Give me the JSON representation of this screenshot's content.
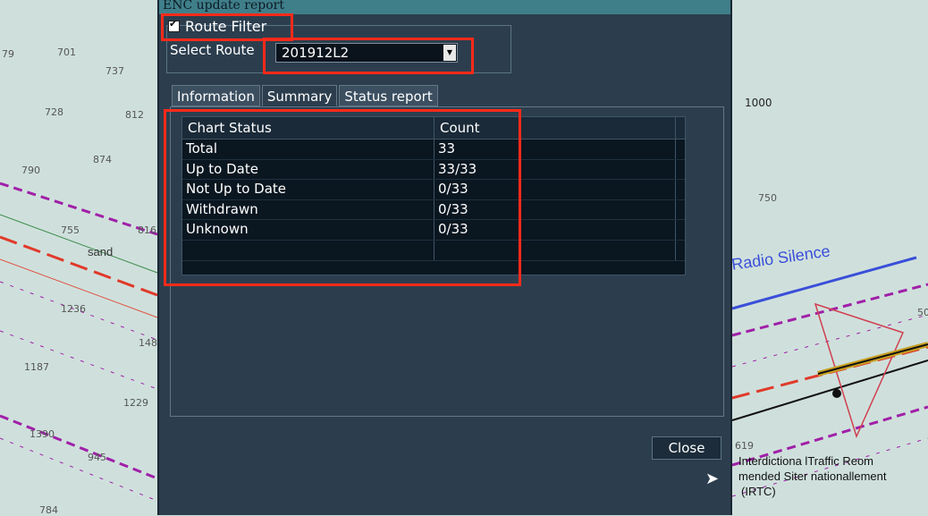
{
  "dialog": {
    "title": "ENC update report",
    "route_filter_label": "Route Filter",
    "route_filter_checked": true,
    "select_route_label": "Select Route",
    "selected_route": "201912L2",
    "close_label": "Close"
  },
  "tabs": [
    {
      "label": "Information",
      "active": false
    },
    {
      "label": "Summary",
      "active": true
    },
    {
      "label": "Status report",
      "active": false
    }
  ],
  "table": {
    "headers": [
      "Chart Status",
      "Count"
    ],
    "rows": [
      [
        "Total",
        "33"
      ],
      [
        "Up to Date",
        "33/33"
      ],
      [
        "Not Up to Date",
        "0/33"
      ],
      [
        "Withdrawn",
        "0/33"
      ],
      [
        "Unknown",
        "0/33"
      ]
    ]
  },
  "map": {
    "left_soundings": [
      "79",
      "701",
      "737",
      "728",
      "812",
      "874",
      "790",
      "755",
      "816",
      "1236",
      "148",
      "1187",
      "1229",
      "1390",
      "945",
      "784"
    ],
    "sand_label": "sand",
    "right_soundings": [
      "1000",
      "750",
      "50",
      "619"
    ],
    "radio_silence": "Radio Silence",
    "overlap_label_1": "Interdiction and Recommended Traffic Separation",
    "overlap_label_2": "International Route Corridor (IRTC)",
    "overlap_line_1": "Interdictiona lTraffic Reom",
    "overlap_line_2": "mended Siter nationallement",
    "overlap_line_3": "(IRTC)"
  },
  "colors": {
    "dialog_bg": "#2c3e4e",
    "highlight_red": "#ff2a1a",
    "map_bg": "#cfe0dc"
  }
}
